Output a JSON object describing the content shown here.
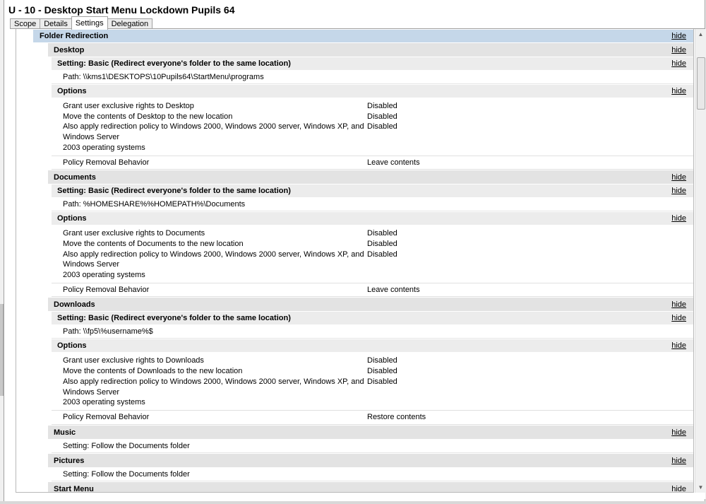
{
  "window": {
    "title": "U - 10 - Desktop Start Menu Lockdown Pupils 64"
  },
  "tabs": [
    {
      "label": "Scope"
    },
    {
      "label": "Details"
    },
    {
      "label": "Settings"
    },
    {
      "label": "Delegation"
    }
  ],
  "report": {
    "section_title": "Folder Redirection",
    "hide_label": "hide",
    "options_title": "Options",
    "basic_setting": "Setting: Basic (Redirect everyone's folder to the same location)",
    "removal_label": "Policy Removal Behavior",
    "desktop": {
      "title": "Desktop",
      "path": "Path: \\\\kms1\\DESKTOPS\\10Pupils64\\StartMenu\\programs",
      "options": [
        {
          "label": "Grant user exclusive rights to Desktop",
          "value": "Disabled"
        },
        {
          "label": "Move the contents of Desktop to the new location",
          "value": "Disabled"
        },
        {
          "label": "Also apply redirection policy to Windows 2000, Windows 2000 server, Windows XP, and Windows Server",
          "value": "Disabled"
        },
        {
          "label": "2003 operating systems",
          "value": ""
        }
      ],
      "removal_value": "Leave contents"
    },
    "documents": {
      "title": "Documents",
      "path": "Path: %HOMESHARE%%HOMEPATH%\\Documents",
      "options": [
        {
          "label": "Grant user exclusive rights to Documents",
          "value": "Disabled"
        },
        {
          "label": "Move the contents of Documents to the new location",
          "value": "Disabled"
        },
        {
          "label": "Also apply redirection policy to Windows 2000, Windows 2000 server, Windows XP, and Windows Server",
          "value": "Disabled"
        },
        {
          "label": "2003 operating systems",
          "value": ""
        }
      ],
      "removal_value": "Leave contents"
    },
    "downloads": {
      "title": "Downloads",
      "path": "Path: \\\\fp5\\%username%$",
      "options": [
        {
          "label": "Grant user exclusive rights to Downloads",
          "value": "Disabled"
        },
        {
          "label": "Move the contents of Downloads to the new location",
          "value": "Disabled"
        },
        {
          "label": "Also apply redirection policy to Windows 2000, Windows 2000 server, Windows XP, and Windows Server",
          "value": "Disabled"
        },
        {
          "label": "2003 operating systems",
          "value": ""
        }
      ],
      "removal_value": "Restore contents"
    },
    "music": {
      "title": "Music",
      "setting": "Setting: Follow the Documents folder"
    },
    "pictures": {
      "title": "Pictures",
      "setting": "Setting: Follow the Documents folder"
    },
    "start_menu": {
      "title": "Start Menu"
    }
  },
  "icons": {
    "scroll_up": "scroll-up-arrow-icon",
    "scroll_down": "scroll-down-arrow-icon"
  },
  "colors": {
    "section_header": "#c5d7e9",
    "subsection_header": "#e3e3e3",
    "setting_header": "#ececec"
  }
}
